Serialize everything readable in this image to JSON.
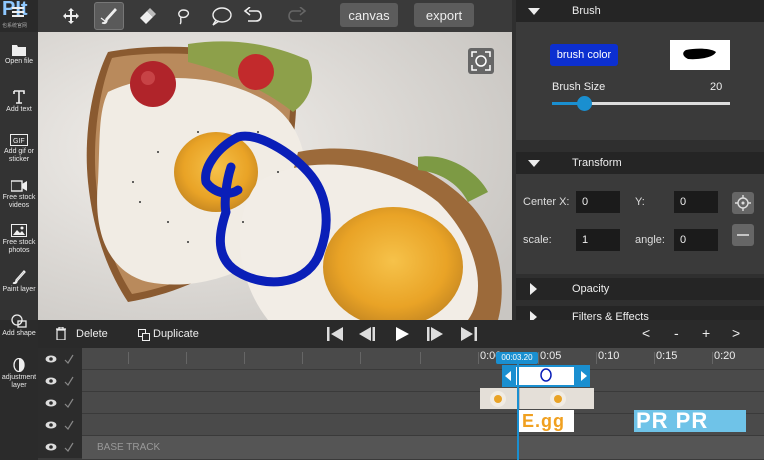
{
  "app": {
    "logo_text": "PIt",
    "logo_sub": "也系统官网"
  },
  "toolbar": {
    "tools": [
      "move-tool",
      "brush-tool",
      "eraser-tool",
      "lasso-tool",
      "speech-bubble-tool",
      "undo",
      "redo"
    ],
    "active_tool": "brush-tool",
    "canvas_label": "canvas",
    "export_label": "export"
  },
  "sidebar": {
    "items": [
      {
        "label": "Open file"
      },
      {
        "label": "Add text"
      },
      {
        "label": "Add gif or sticker"
      },
      {
        "label": "Free stock videos"
      },
      {
        "label": "Free stock photos"
      },
      {
        "label": "Paint layer"
      },
      {
        "label": "Add shape"
      },
      {
        "label": "adjustment layer"
      }
    ]
  },
  "panel": {
    "brush": {
      "header": "Brush",
      "color_button": "brush color",
      "size_label": "Brush Size",
      "size_value": "20",
      "size_fraction": 0.18
    },
    "transform": {
      "header": "Transform",
      "center_x_label": "Center X:",
      "center_x": "0",
      "y_label": "Y:",
      "y": "0",
      "scale_label": "scale:",
      "scale": "1",
      "angle_label": "angle:",
      "angle": "0"
    },
    "opacity": {
      "header": "Opacity"
    },
    "filters": {
      "header": "Filters & Effects"
    }
  },
  "timeline": {
    "delete_label": "Delete",
    "duplicate_label": "Duplicate",
    "zoom_prev": "<",
    "zoom_minus": "-",
    "zoom_plus": "+",
    "zoom_next": ">",
    "playhead_time": "00:03.20",
    "ticks": [
      "0:00",
      "0:05",
      "0:10",
      "0:15",
      "0:20"
    ],
    "base_track_label": "BASE TRACK",
    "clip_text": "E.gg",
    "clip_text2": "PR PR"
  },
  "colors": {
    "brush_blue": "#0a1fb8",
    "accent_blue": "#1a8fd0",
    "button_blue": "#0c2fd0"
  }
}
